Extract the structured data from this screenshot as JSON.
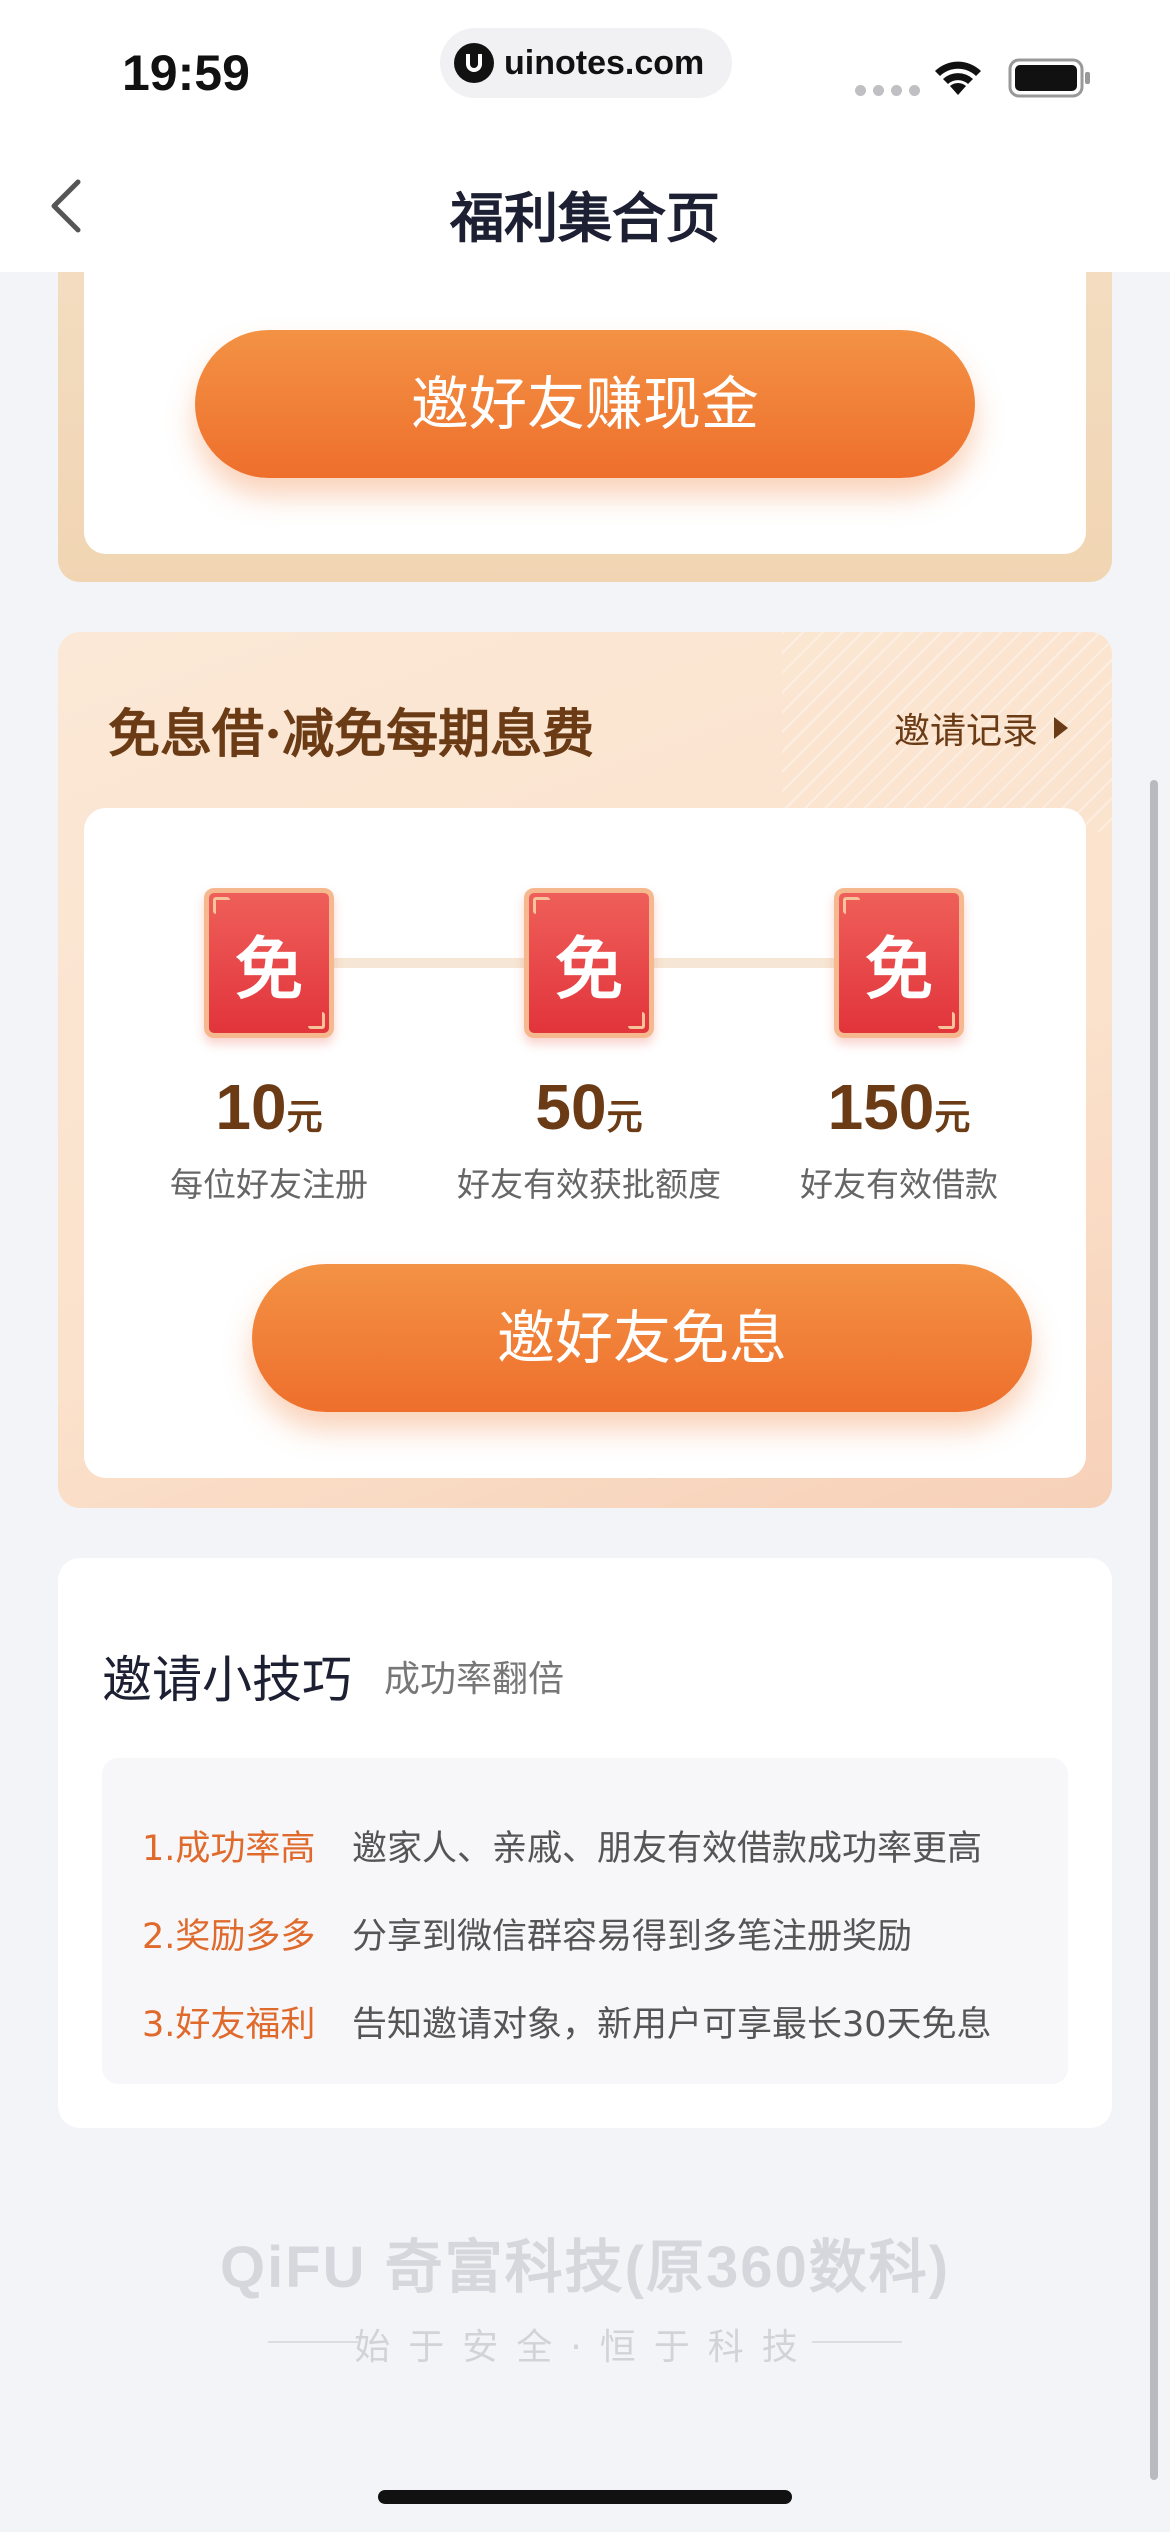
{
  "status_bar": {
    "time": "19:59",
    "url": "uinotes.com"
  },
  "nav": {
    "title": "福利集合页"
  },
  "card_cash": {
    "button_label": "邀好友赚现金"
  },
  "card_free": {
    "title": "免息借·减免每期息费",
    "record_link": "邀请记录",
    "badge_text": "免",
    "rewards": [
      {
        "amount": "10",
        "unit": "元",
        "desc": "每位好友注册"
      },
      {
        "amount": "50",
        "unit": "元",
        "desc": "好友有效获批额度"
      },
      {
        "amount": "150",
        "unit": "元",
        "desc": "好友有效借款"
      }
    ],
    "button_label": "邀好友免息"
  },
  "tips": {
    "title": "邀请小技巧",
    "subtitle": "成功率翻倍",
    "items": [
      {
        "label": "1.成功率高",
        "text": "邀家人、亲戚、朋友有效借款成功率更高"
      },
      {
        "label": "2.奖励多多",
        "text": "分享到微信群容易得到多笔注册奖励"
      },
      {
        "label": "3.好友福利",
        "text": "告知邀请对象，新用户可享最长30天免息"
      }
    ]
  },
  "footer": {
    "logo": "QiFU 奇富科技(原360数科)",
    "slogan": "始于安全·恒于科技"
  },
  "colors": {
    "accent_orange": "#ee6f2c",
    "brown_text": "#6b3b16",
    "badge_red": "#e1343b"
  }
}
